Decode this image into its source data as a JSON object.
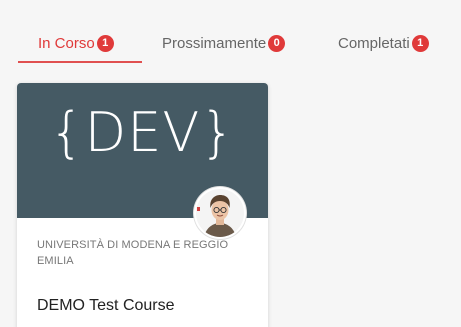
{
  "tabs": [
    {
      "label": "In Corso",
      "badge": "1"
    },
    {
      "label": "Prossimamente",
      "badge": "0"
    },
    {
      "label": "Completati",
      "badge": "1"
    }
  ],
  "active_tab": "In Corso",
  "colors": {
    "accent": "#e03a3a",
    "banner": "#455a64"
  },
  "course": {
    "banner_text": "{DEV}",
    "institution": "UNIVERSITÀ DI MODENA E REGGIO EMILIA",
    "title": "DEMO Test Course",
    "avatar": "instructor-avatar"
  }
}
